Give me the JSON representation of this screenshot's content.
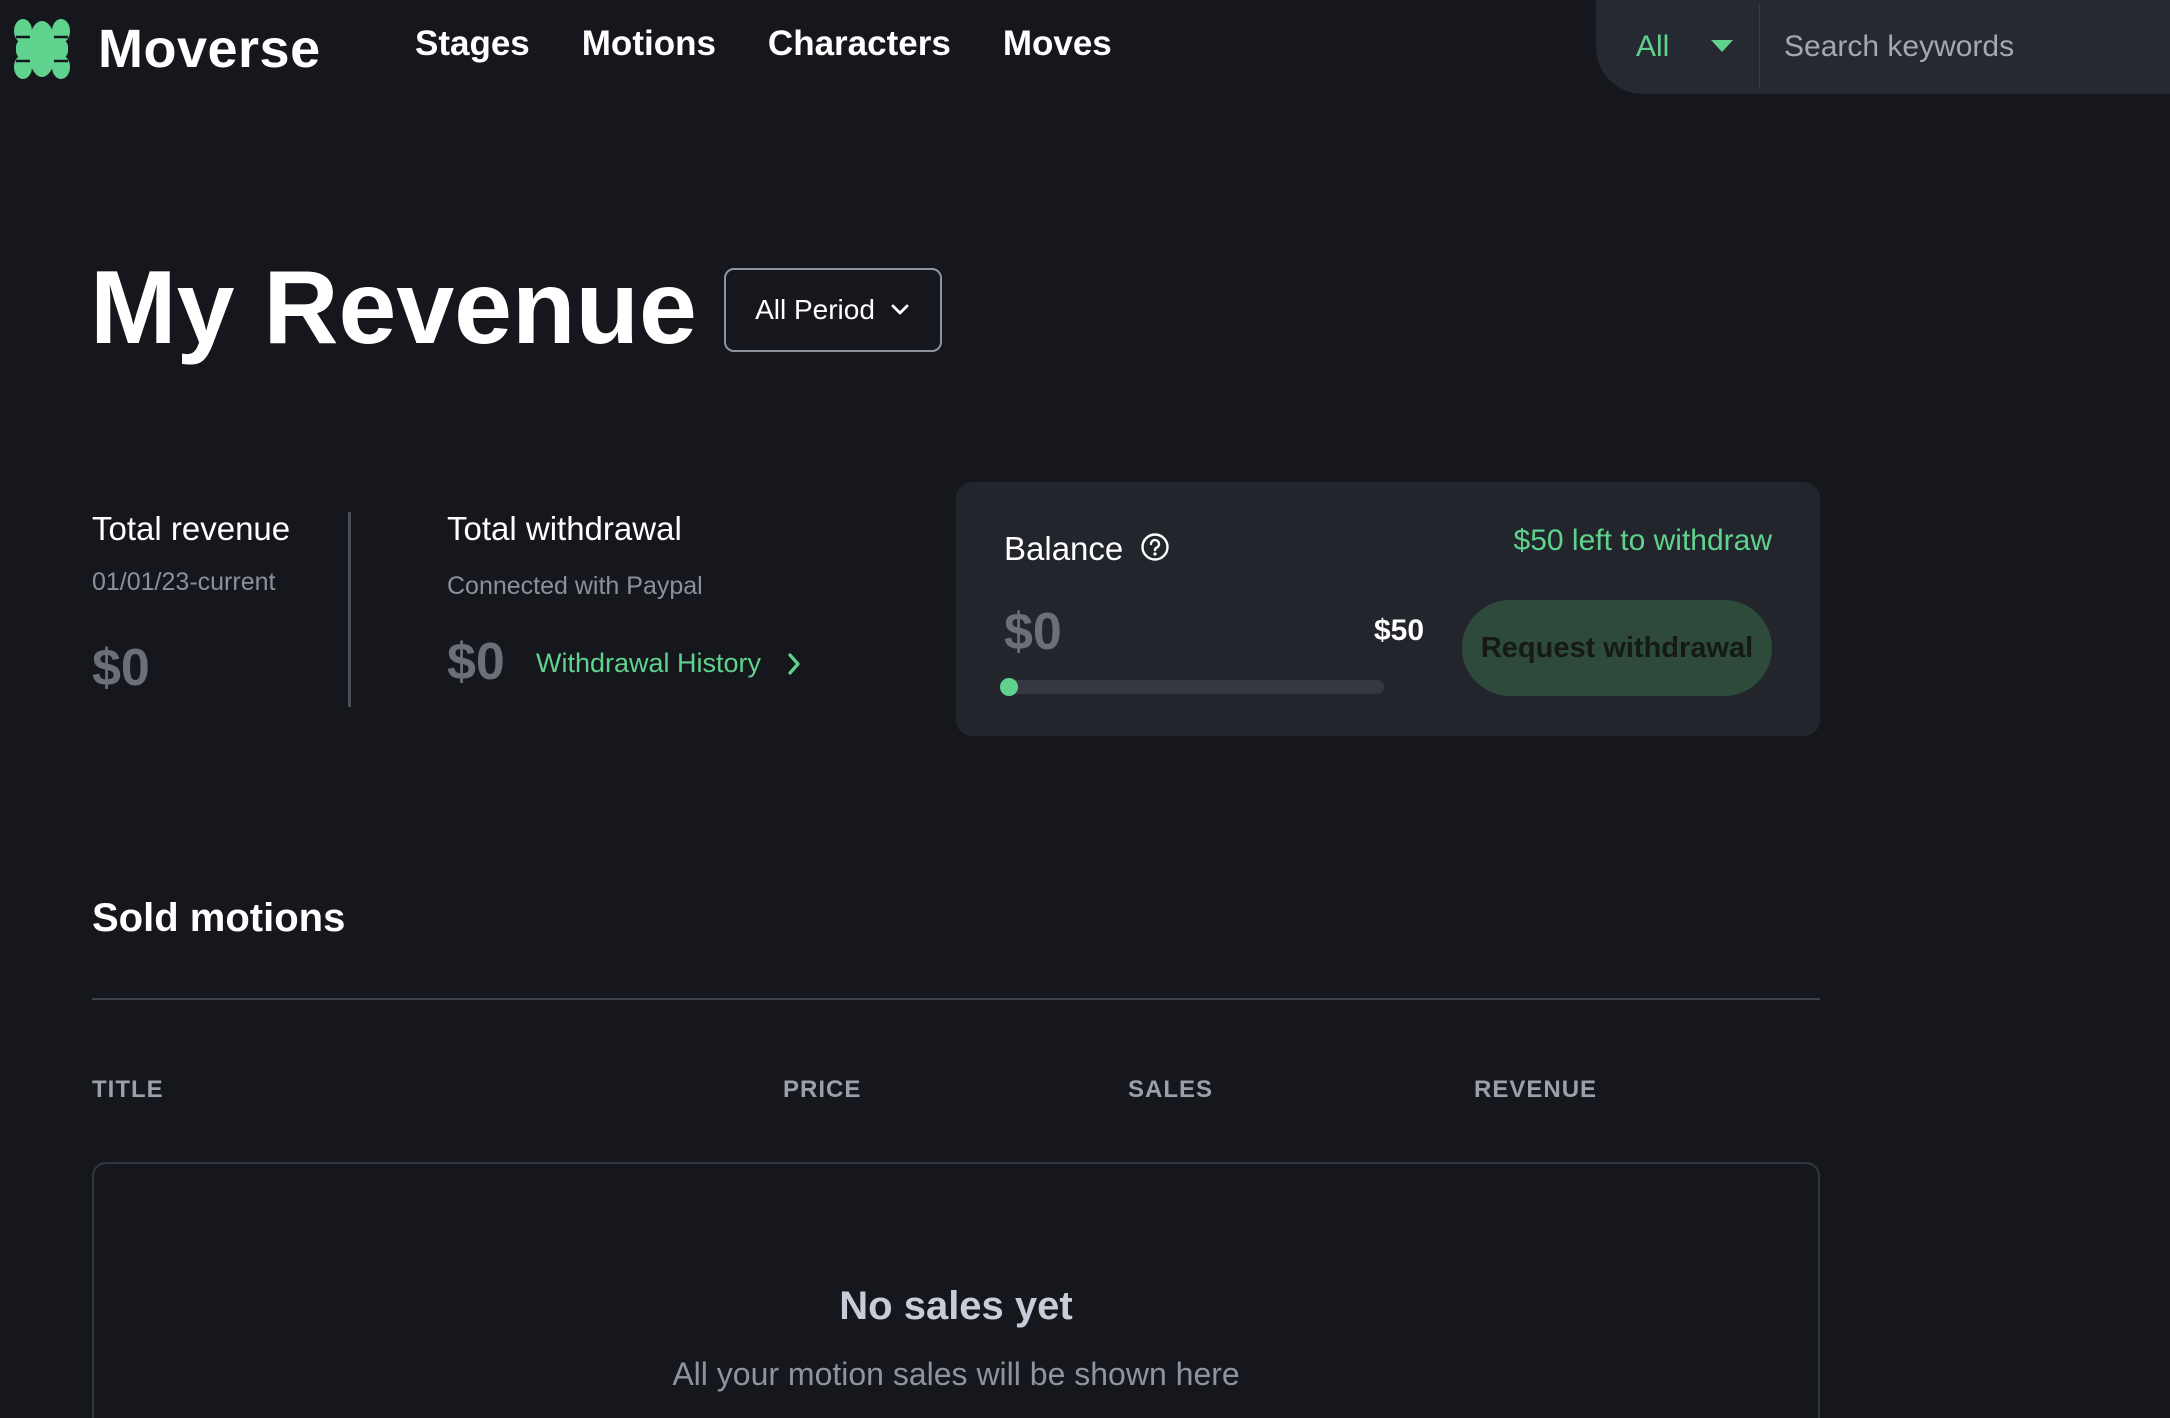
{
  "brand": {
    "name": "Moverse",
    "accent": "#5fd38d"
  },
  "nav": {
    "items": [
      "Stages",
      "Motions",
      "Characters",
      "Moves"
    ]
  },
  "search": {
    "category": "All",
    "placeholder": "Search keywords"
  },
  "header": {
    "title": "My Revenue",
    "period_label": "All Period"
  },
  "stats": {
    "total_revenue": {
      "label": "Total revenue",
      "sub": "01/01/23-current",
      "value": "$0"
    },
    "total_withdrawal": {
      "label": "Total withdrawal",
      "sub": "Connected with Paypal",
      "value": "$0",
      "history_link": "Withdrawal History"
    }
  },
  "balance": {
    "title": "Balance",
    "left_to_withdraw": "$50 left to withdraw",
    "value": "$0",
    "goal": "$50",
    "progress": 0,
    "request_button": "Request withdrawal"
  },
  "sold_motions": {
    "title": "Sold motions",
    "columns": [
      "TITLE",
      "PRICE",
      "SALES",
      "REVENUE"
    ],
    "empty_title": "No sales yet",
    "empty_sub": "All your motion sales will be shown here"
  }
}
